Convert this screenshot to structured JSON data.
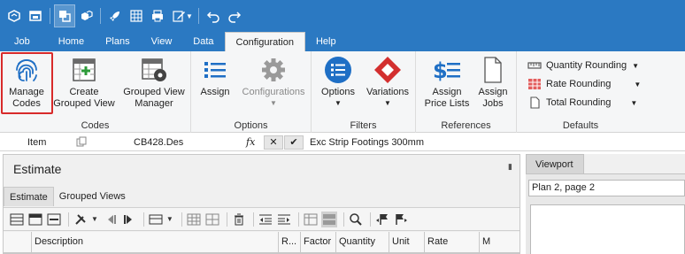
{
  "menu_tabs": [
    "Job",
    "Home",
    "Plans",
    "View",
    "Data",
    "Configuration",
    "Help"
  ],
  "active_tab": "Configuration",
  "groups": {
    "codes": {
      "label": "Codes",
      "manage_codes": "Manage\nCodes",
      "create_grouped_view": "Create\nGrouped View",
      "grouped_view_manager": "Grouped View\nManager"
    },
    "options": {
      "label": "Options",
      "assign": "Assign",
      "configurations": "Configurations"
    },
    "filters": {
      "label": "Filters",
      "options": "Options",
      "variations": "Variations"
    },
    "references": {
      "label": "References",
      "assign_price_lists": "Assign\nPrice Lists",
      "assign_jobs": "Assign\nJobs"
    },
    "defaults": {
      "label": "Defaults",
      "quantity_rounding": "Quantity Rounding",
      "rate_rounding": "Rate Rounding",
      "total_rounding": "Total Rounding"
    }
  },
  "formula_bar": {
    "item_label": "Item",
    "code": "CB428.Des",
    "fx": "fx",
    "value": "Exc Strip Footings 300mm"
  },
  "estimate_panel": {
    "title": "Estimate",
    "subtabs": [
      "Estimate",
      "Grouped Views"
    ],
    "columns": [
      "Description",
      "R...",
      "Factor",
      "Quantity",
      "Unit",
      "Rate",
      "M"
    ]
  },
  "viewport_panel": {
    "tab": "Viewport",
    "selected_page": "Plan 2, page 2"
  },
  "colors": {
    "titlebar": "#2b79c2",
    "accent_blue": "#1f6fc5",
    "highlight_red": "#d82a2a",
    "variations_red": "#d32f2f"
  }
}
